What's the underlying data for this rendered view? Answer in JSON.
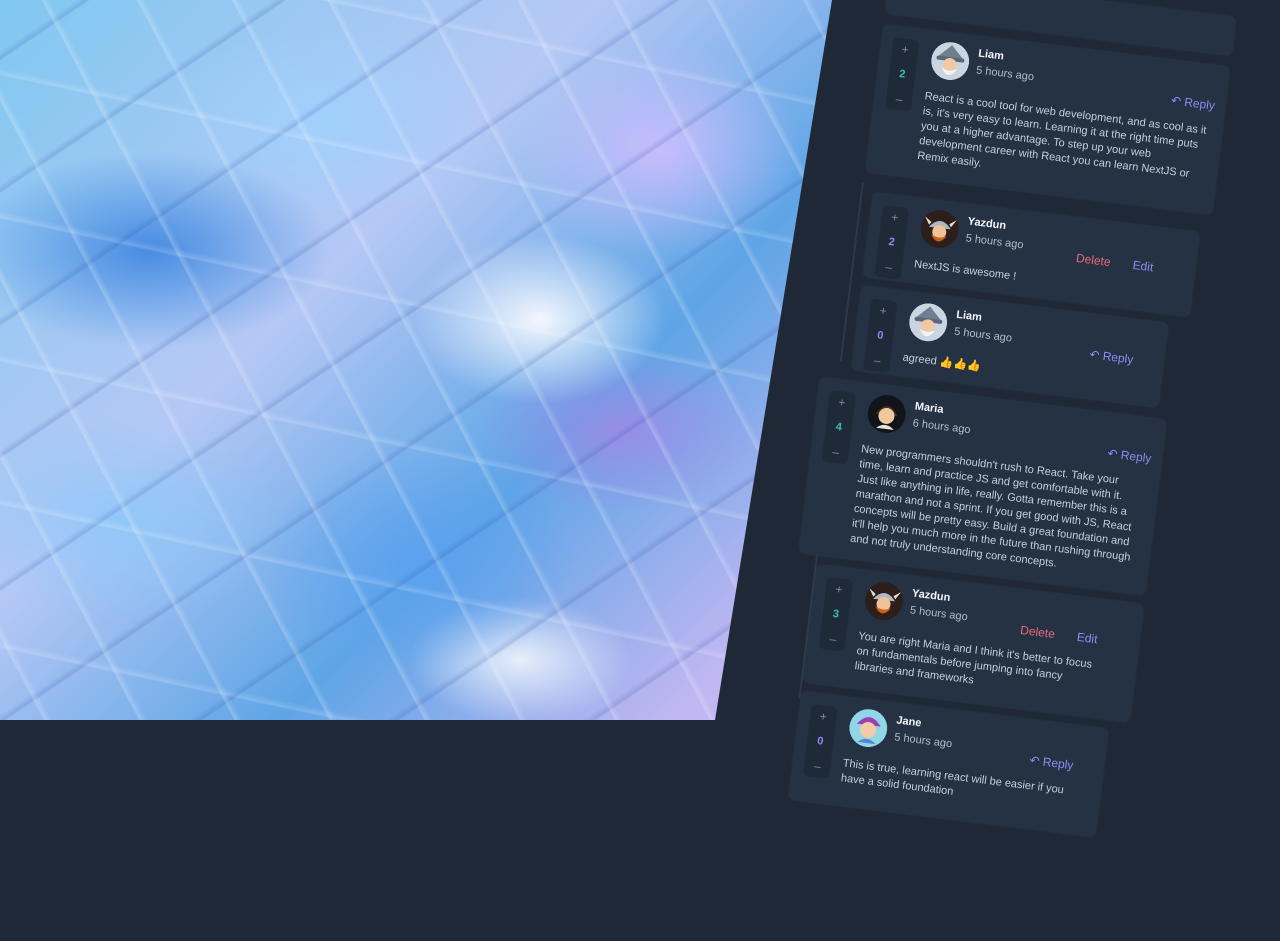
{
  "hero": {
    "description_icon": "iridescent-foil-image"
  },
  "colors": {
    "accent": "#8c8cf2",
    "danger": "#e96a78",
    "score_green": "#35c3a0",
    "score_purple": "#8c8cf2"
  },
  "comments": [
    {
      "author": "Liam",
      "time": "5 hours ago",
      "score": "2",
      "action": "Reply",
      "text": "React is a cool tool for web development, and as cool as it is, it's very easy to learn. Learning it at the right time puts you at a higher advantage. To step up your web development career with React you can learn NextJS or Remix easily."
    },
    {
      "author": "Yazdun",
      "time": "5 hours ago",
      "score": "2",
      "delete": "Delete",
      "edit": "Edit",
      "text": "NextJS is awesome !"
    },
    {
      "author": "Liam",
      "time": "5 hours ago",
      "score": "0",
      "action": "Reply",
      "text": "agreed 👍👍👍"
    },
    {
      "author": "Maria",
      "time": "6 hours ago",
      "score": "4",
      "action": "Reply",
      "text": "New programmers shouldn't rush to React. Take your time, learn and practice JS and get comfortable with it. Just like anything in life, really. Gotta remember this is a marathon and not a sprint. If you get good with JS, React concepts will be pretty easy. Build a great foundation and it'll help you much more in the future than rushing through and not truly understanding core concepts."
    },
    {
      "author": "Yazdun",
      "time": "5 hours ago",
      "score": "3",
      "delete": "Delete",
      "edit": "Edit",
      "text": "You are right Maria and I think it's better to focus on fundamentals before jumping into fancy libraries and frameworks"
    },
    {
      "author": "Jane",
      "time": "5 hours ago",
      "score": "0",
      "action": "Reply",
      "text": "This is true, learning react will be easier if you have a solid foundation"
    }
  ],
  "vote": {
    "up": "+",
    "down": "–"
  },
  "icons": {
    "reply": "↶"
  }
}
